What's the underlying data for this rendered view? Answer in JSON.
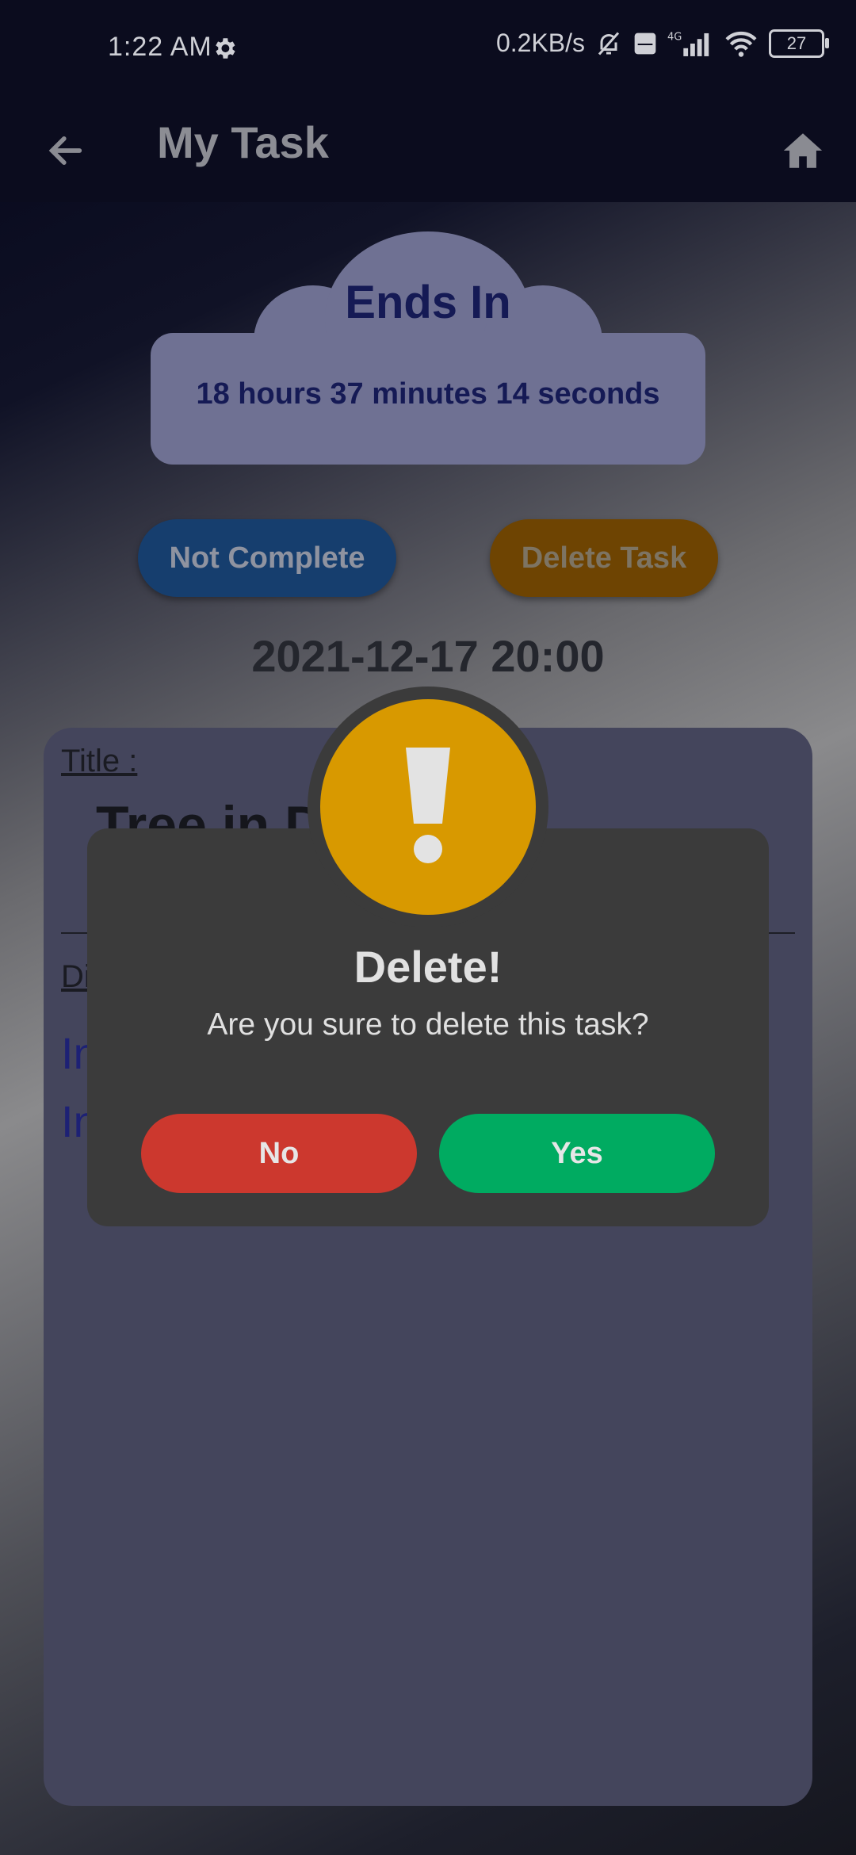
{
  "status_bar": {
    "time": "1:22 AM",
    "network_speed": "0.2KB/s",
    "volte": "Vo LTE",
    "network_type": "4G",
    "battery": "27",
    "icons": [
      "settings-gear-icon",
      "muted-bell-icon",
      "volte-icon",
      "signal-icon",
      "wifi-icon",
      "battery-icon"
    ]
  },
  "app_bar": {
    "title": "My Task",
    "back_icon": "back-arrow-icon",
    "home_icon": "home-icon"
  },
  "timer": {
    "title": "Ends In",
    "remaining": "18 hours 37 minutes 14 seconds"
  },
  "actions": {
    "not_complete": "Not Complete",
    "delete_task": "Delete Task"
  },
  "deadline": "2021-12-17 20:00",
  "details": {
    "title_label": "Title :",
    "title_value": "Tree in D",
    "description_label": "Di",
    "description_lines": [
      "In",
      "In"
    ]
  },
  "dialog": {
    "icon": "exclamation-icon",
    "title": "Delete!",
    "message": "Are you sure to delete this task?",
    "no_label": "No",
    "yes_label": "Yes"
  },
  "colors": {
    "accent_blue": "#163e6e",
    "accent_orange": "#6e4402",
    "warning": "#d89900",
    "no_red": "#cc382e",
    "yes_green": "#00ab61"
  }
}
